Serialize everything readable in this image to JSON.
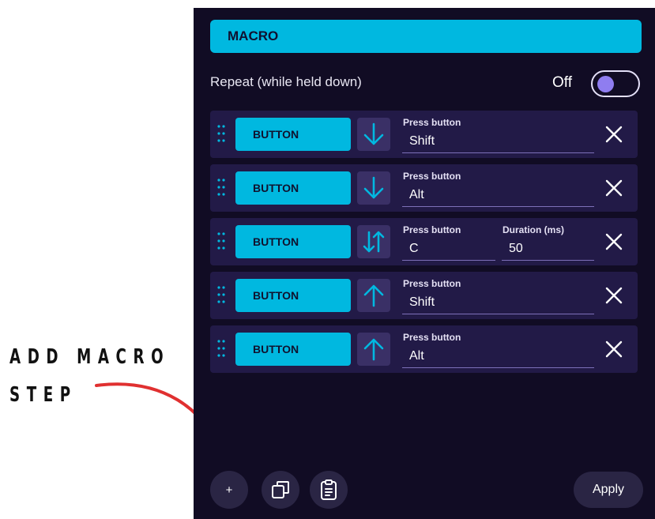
{
  "annotation": {
    "text": "ADD MACRO\nSTEP",
    "arrow_color": "#e03030"
  },
  "panel": {
    "title": "MACRO",
    "repeat_label": "Repeat (while held down)",
    "toggle_state": "Off",
    "accent": "#00b8e0",
    "background": "#110c24"
  },
  "steps": [
    {
      "type": "BUTTON",
      "direction": "down",
      "field_label": "Press button",
      "value": "Shift"
    },
    {
      "type": "BUTTON",
      "direction": "down",
      "field_label": "Press button",
      "value": "Alt"
    },
    {
      "type": "BUTTON",
      "direction": "down-up",
      "field_label": "Press button",
      "value": "C",
      "duration_label": "Duration (ms)",
      "duration": "50"
    },
    {
      "type": "BUTTON",
      "direction": "up",
      "field_label": "Press button",
      "value": "Shift"
    },
    {
      "type": "BUTTON",
      "direction": "up",
      "field_label": "Press button",
      "value": "Alt"
    }
  ],
  "footer": {
    "add_label": "+",
    "add_icon": "plus-icon",
    "copy_icon": "copy-icon",
    "paste_icon": "clipboard-icon",
    "apply_label": "Apply"
  }
}
